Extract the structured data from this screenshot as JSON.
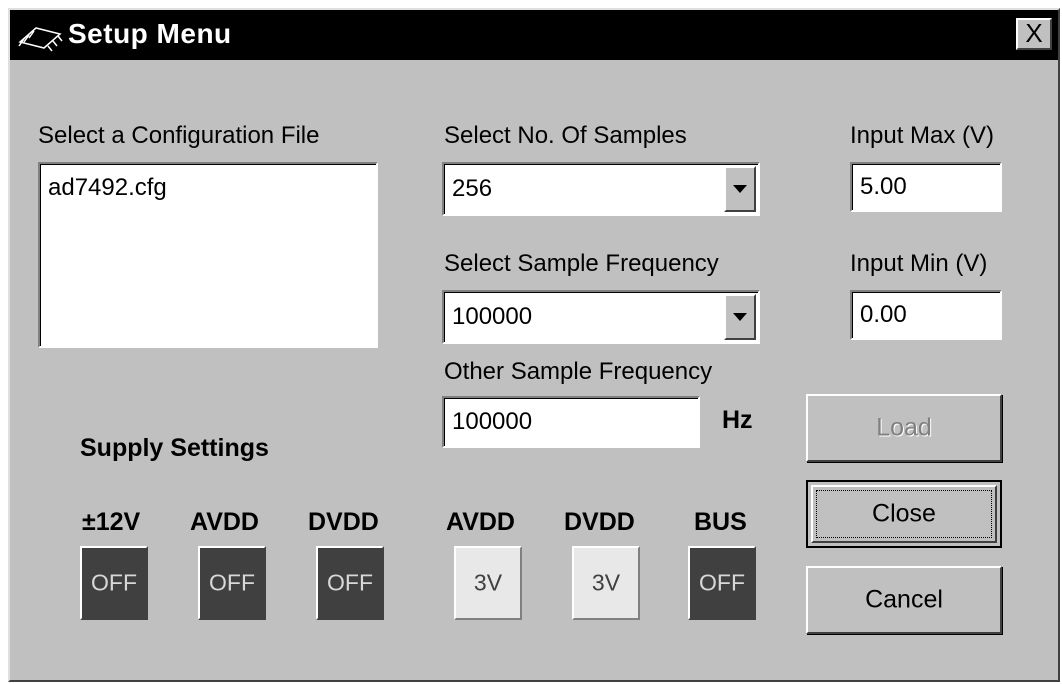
{
  "window": {
    "title": "Setup Menu",
    "close_glyph": "X",
    "app_icon": "chip-icon"
  },
  "config": {
    "label": "Select a Configuration File",
    "files": [
      "ad7492.cfg"
    ]
  },
  "samples": {
    "label": "Select No. Of Samples",
    "value": "256"
  },
  "sample_freq": {
    "label": "Select Sample Frequency",
    "value": "100000"
  },
  "other_freq": {
    "label": "Other Sample Frequency",
    "value": "100000",
    "unit": "Hz"
  },
  "input_max": {
    "label": "Input Max (V)",
    "value": "5.00"
  },
  "input_min": {
    "label": "Input Min (V)",
    "value": "0.00"
  },
  "buttons": {
    "load": "Load",
    "close": "Close",
    "cancel": "Cancel"
  },
  "supply": {
    "heading": "Supply Settings",
    "toggles": [
      {
        "label": "±12V",
        "state": "OFF"
      },
      {
        "label": "AVDD",
        "state": "OFF"
      },
      {
        "label": "DVDD",
        "state": "OFF"
      },
      {
        "label": "AVDD",
        "state": "3V"
      },
      {
        "label": "DVDD",
        "state": "3V"
      },
      {
        "label": "BUS",
        "state": "OFF"
      }
    ]
  },
  "colors": {
    "face": "#c0c0c0",
    "titlebar": "#000000",
    "toggle_off": "#404040",
    "toggle_on": "#e8e8e8"
  }
}
